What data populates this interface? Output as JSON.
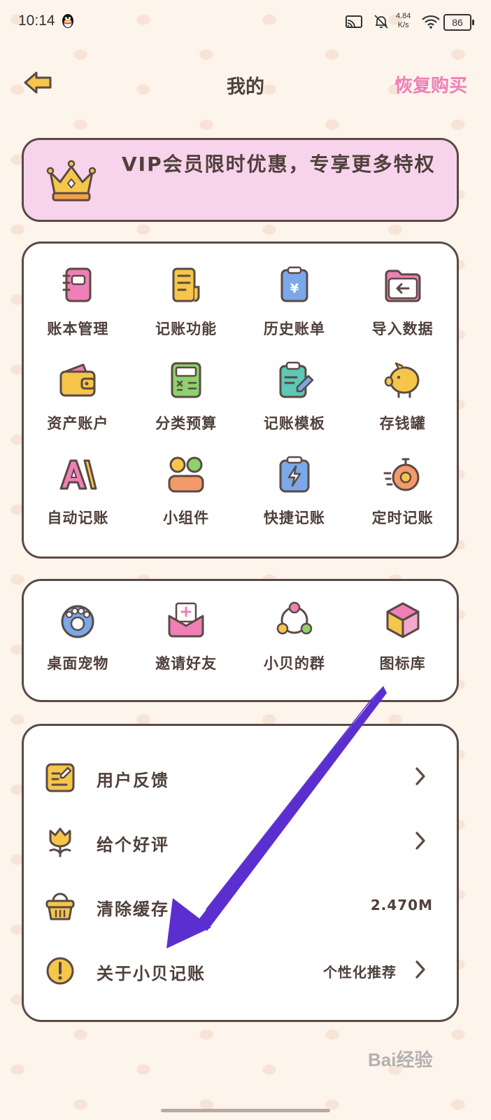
{
  "status_bar": {
    "time": "10:14",
    "net_speed_value": "4.84",
    "net_speed_unit": "K/s",
    "battery": "86"
  },
  "header": {
    "title": "我的",
    "restore_label": "恢复购买"
  },
  "vip_banner": {
    "text": "VIP会员限时优惠，专享更多特权"
  },
  "features": [
    {
      "label": "账本管理",
      "icon": "ledger-book-icon"
    },
    {
      "label": "记账功能",
      "icon": "bookkeeping-doc-icon"
    },
    {
      "label": "历史账单",
      "icon": "history-bill-icon"
    },
    {
      "label": "导入数据",
      "icon": "import-folder-icon"
    },
    {
      "label": "资产账户",
      "icon": "wallet-icon"
    },
    {
      "label": "分类预算",
      "icon": "calculator-icon"
    },
    {
      "label": "记账模板",
      "icon": "template-clipboard-icon"
    },
    {
      "label": "存钱罐",
      "icon": "piggy-bank-icon"
    },
    {
      "label": "自动记账",
      "icon": "auto-ai-icon"
    },
    {
      "label": "小组件",
      "icon": "widget-icon"
    },
    {
      "label": "快捷记账",
      "icon": "quick-bolt-icon"
    },
    {
      "label": "定时记账",
      "icon": "timer-icon"
    }
  ],
  "extras": [
    {
      "label": "桌面宠物",
      "icon": "paw-icon"
    },
    {
      "label": "邀请好友",
      "icon": "invite-envelope-icon"
    },
    {
      "label": "小贝的群",
      "icon": "group-icon"
    },
    {
      "label": "图标库",
      "icon": "cube-icon"
    }
  ],
  "settings": [
    {
      "label": "用户反馈",
      "value": "",
      "icon": "feedback-edit-icon"
    },
    {
      "label": "给个好评",
      "value": "",
      "icon": "tulip-icon"
    },
    {
      "label": "清除缓存",
      "value": "2.470M",
      "icon": "basket-icon"
    },
    {
      "label": "关于小贝记账",
      "value": "个性化推荐",
      "icon": "info-icon"
    }
  ],
  "watermark": "Bai经验",
  "colors": {
    "accent_pink": "#ef7fb7",
    "vip_bg": "#f7d4eb",
    "border": "#5a4a45",
    "arrow": "#5b2fcf"
  }
}
